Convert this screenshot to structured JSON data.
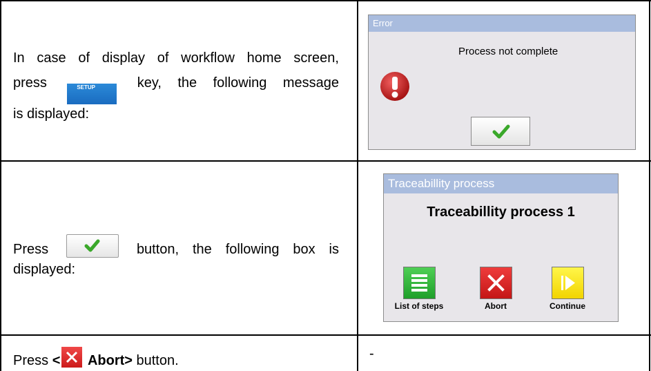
{
  "row1": {
    "text_line1": "In case of display of workflow home screen,",
    "text_press": "press",
    "setup_key_label": "SETUP",
    "text_after_key": "key, the following message",
    "text_line3": "is displayed:",
    "dialog": {
      "title": "Error",
      "message": "Process not complete"
    }
  },
  "row2": {
    "text_press": "Press",
    "text_after_btn": "button, the following box is",
    "text_line2": "displayed:",
    "dialog": {
      "title": "Traceabillity process",
      "heading": "Traceabillity process 1",
      "buttons": [
        "List of steps",
        "Abort",
        "Continue"
      ]
    }
  },
  "row3": {
    "text_press": "Press",
    "text_lt": "<",
    "text_abort": "Abort>",
    "text_tail": " button.",
    "right_cell": "-"
  }
}
